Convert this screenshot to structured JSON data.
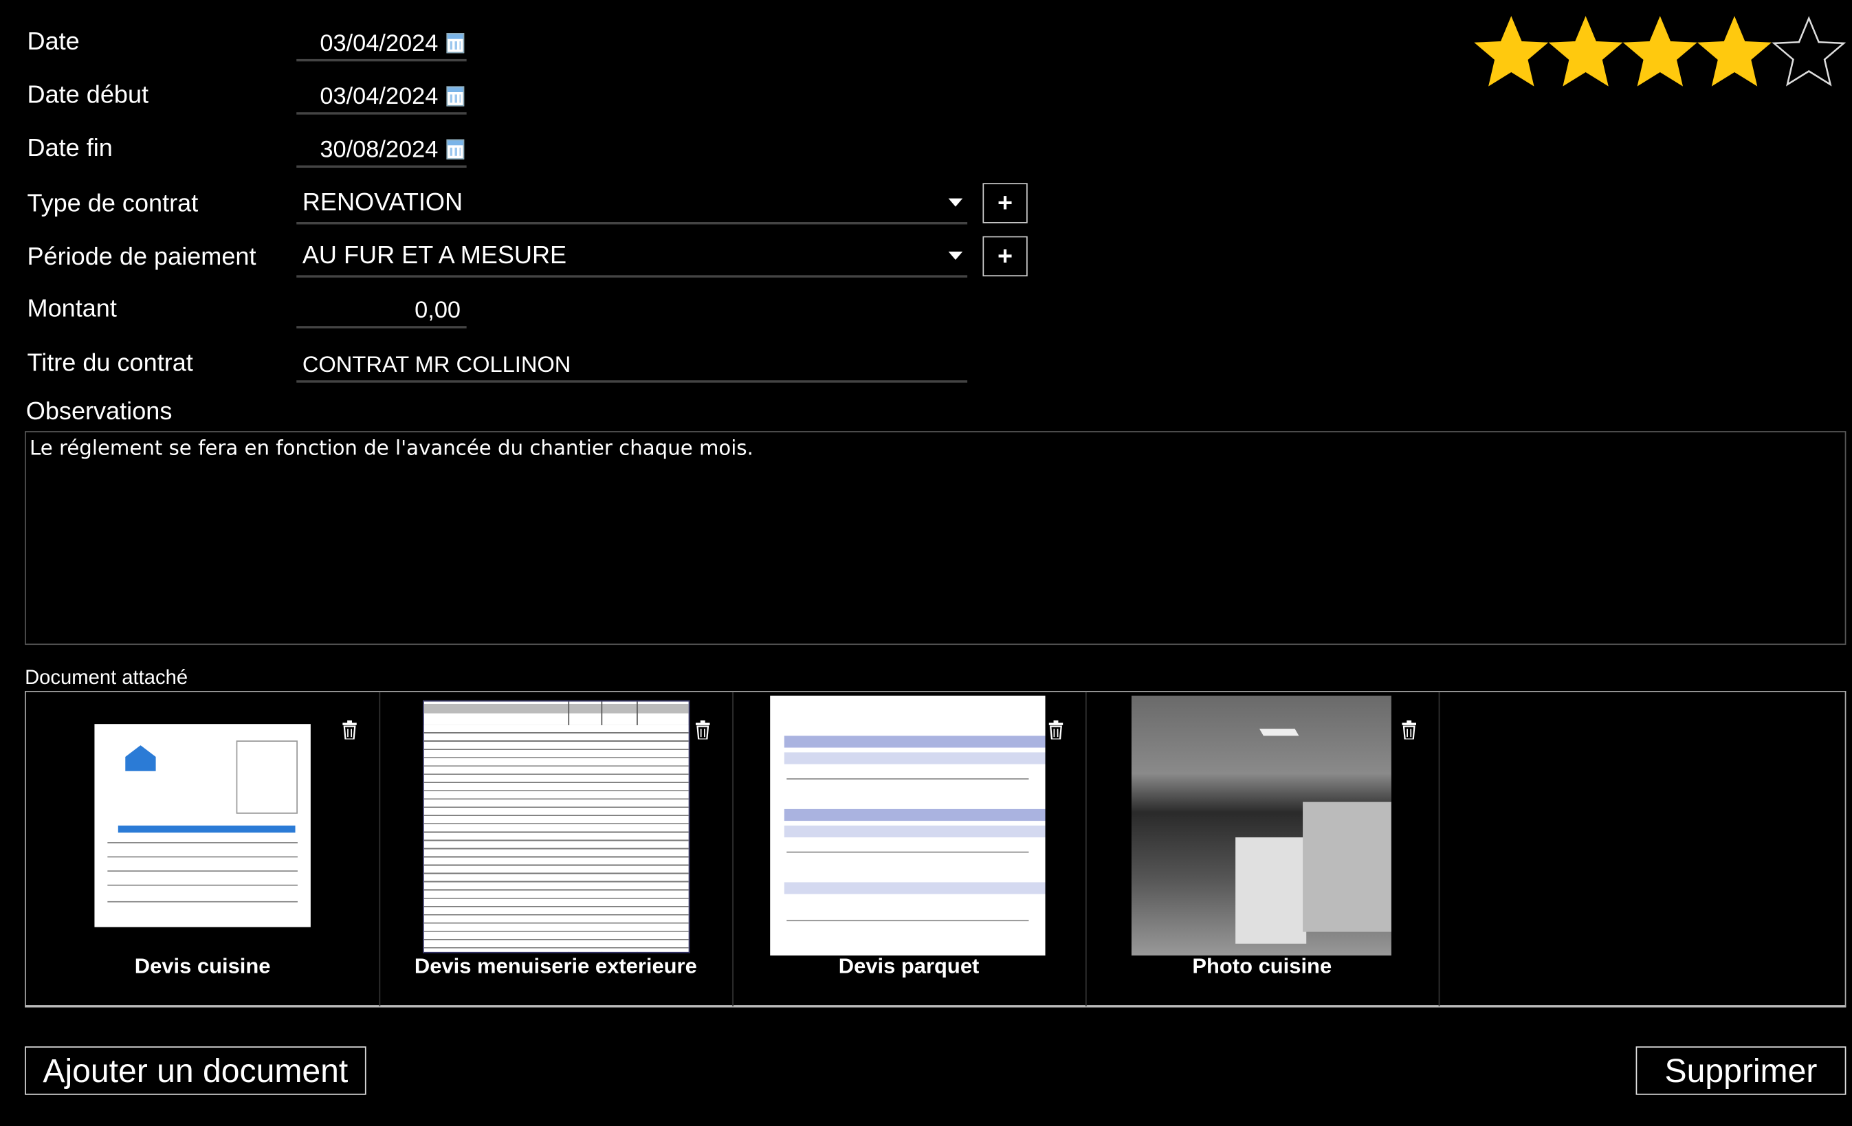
{
  "form": {
    "date": {
      "label": "Date",
      "value": "03/04/2024"
    },
    "date_debut": {
      "label": "Date début",
      "value": "03/04/2024"
    },
    "date_fin": {
      "label": "Date fin",
      "value": "30/08/2024"
    },
    "type_contrat": {
      "label": "Type de contrat",
      "value": "RENOVATION",
      "add": "+"
    },
    "periode_paiement": {
      "label": "Période de paiement",
      "value": "AU FUR ET A MESURE",
      "add": "+"
    },
    "montant": {
      "label": "Montant",
      "value": "0,00"
    },
    "titre": {
      "label": "Titre du contrat",
      "value": "CONTRAT MR COLLINON"
    },
    "observations": {
      "label": "Observations",
      "value": "Le réglement se fera en fonction de l'avancée du chantier chaque mois."
    }
  },
  "rating": {
    "value": 4,
    "max": 5,
    "color": "#FFC90E"
  },
  "documents": {
    "label": "Document attaché",
    "items": [
      {
        "name": "Devis cuisine",
        "kind": "document"
      },
      {
        "name": "Devis menuiserie exterieure",
        "kind": "document"
      },
      {
        "name": "Devis parquet",
        "kind": "document"
      },
      {
        "name": "Photo cuisine",
        "kind": "photo"
      }
    ]
  },
  "actions": {
    "add_document": "Ajouter un document",
    "delete": "Supprimer"
  }
}
